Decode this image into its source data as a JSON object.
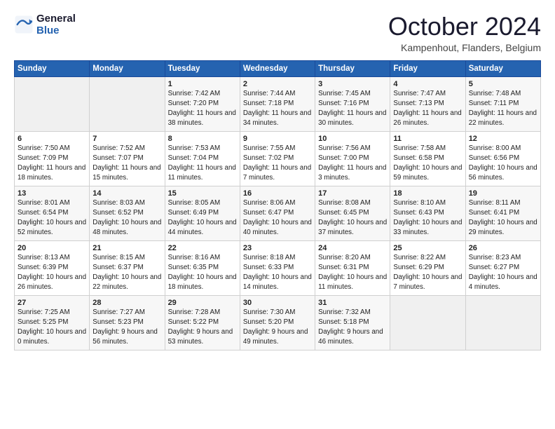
{
  "header": {
    "logo_line1": "General",
    "logo_line2": "Blue",
    "month": "October 2024",
    "location": "Kampenhout, Flanders, Belgium"
  },
  "days_of_week": [
    "Sunday",
    "Monday",
    "Tuesday",
    "Wednesday",
    "Thursday",
    "Friday",
    "Saturday"
  ],
  "weeks": [
    [
      {
        "day": "",
        "empty": true
      },
      {
        "day": "",
        "empty": true
      },
      {
        "day": "1",
        "sunrise": "7:42 AM",
        "sunset": "7:20 PM",
        "daylight": "11 hours and 38 minutes."
      },
      {
        "day": "2",
        "sunrise": "7:44 AM",
        "sunset": "7:18 PM",
        "daylight": "11 hours and 34 minutes."
      },
      {
        "day": "3",
        "sunrise": "7:45 AM",
        "sunset": "7:16 PM",
        "daylight": "11 hours and 30 minutes."
      },
      {
        "day": "4",
        "sunrise": "7:47 AM",
        "sunset": "7:13 PM",
        "daylight": "11 hours and 26 minutes."
      },
      {
        "day": "5",
        "sunrise": "7:48 AM",
        "sunset": "7:11 PM",
        "daylight": "11 hours and 22 minutes."
      }
    ],
    [
      {
        "day": "6",
        "sunrise": "7:50 AM",
        "sunset": "7:09 PM",
        "daylight": "11 hours and 18 minutes."
      },
      {
        "day": "7",
        "sunrise": "7:52 AM",
        "sunset": "7:07 PM",
        "daylight": "11 hours and 15 minutes."
      },
      {
        "day": "8",
        "sunrise": "7:53 AM",
        "sunset": "7:04 PM",
        "daylight": "11 hours and 11 minutes."
      },
      {
        "day": "9",
        "sunrise": "7:55 AM",
        "sunset": "7:02 PM",
        "daylight": "11 hours and 7 minutes."
      },
      {
        "day": "10",
        "sunrise": "7:56 AM",
        "sunset": "7:00 PM",
        "daylight": "11 hours and 3 minutes."
      },
      {
        "day": "11",
        "sunrise": "7:58 AM",
        "sunset": "6:58 PM",
        "daylight": "10 hours and 59 minutes."
      },
      {
        "day": "12",
        "sunrise": "8:00 AM",
        "sunset": "6:56 PM",
        "daylight": "10 hours and 56 minutes."
      }
    ],
    [
      {
        "day": "13",
        "sunrise": "8:01 AM",
        "sunset": "6:54 PM",
        "daylight": "10 hours and 52 minutes."
      },
      {
        "day": "14",
        "sunrise": "8:03 AM",
        "sunset": "6:52 PM",
        "daylight": "10 hours and 48 minutes."
      },
      {
        "day": "15",
        "sunrise": "8:05 AM",
        "sunset": "6:49 PM",
        "daylight": "10 hours and 44 minutes."
      },
      {
        "day": "16",
        "sunrise": "8:06 AM",
        "sunset": "6:47 PM",
        "daylight": "10 hours and 40 minutes."
      },
      {
        "day": "17",
        "sunrise": "8:08 AM",
        "sunset": "6:45 PM",
        "daylight": "10 hours and 37 minutes."
      },
      {
        "day": "18",
        "sunrise": "8:10 AM",
        "sunset": "6:43 PM",
        "daylight": "10 hours and 33 minutes."
      },
      {
        "day": "19",
        "sunrise": "8:11 AM",
        "sunset": "6:41 PM",
        "daylight": "10 hours and 29 minutes."
      }
    ],
    [
      {
        "day": "20",
        "sunrise": "8:13 AM",
        "sunset": "6:39 PM",
        "daylight": "10 hours and 26 minutes."
      },
      {
        "day": "21",
        "sunrise": "8:15 AM",
        "sunset": "6:37 PM",
        "daylight": "10 hours and 22 minutes."
      },
      {
        "day": "22",
        "sunrise": "8:16 AM",
        "sunset": "6:35 PM",
        "daylight": "10 hours and 18 minutes."
      },
      {
        "day": "23",
        "sunrise": "8:18 AM",
        "sunset": "6:33 PM",
        "daylight": "10 hours and 14 minutes."
      },
      {
        "day": "24",
        "sunrise": "8:20 AM",
        "sunset": "6:31 PM",
        "daylight": "10 hours and 11 minutes."
      },
      {
        "day": "25",
        "sunrise": "8:22 AM",
        "sunset": "6:29 PM",
        "daylight": "10 hours and 7 minutes."
      },
      {
        "day": "26",
        "sunrise": "8:23 AM",
        "sunset": "6:27 PM",
        "daylight": "10 hours and 4 minutes."
      }
    ],
    [
      {
        "day": "27",
        "sunrise": "7:25 AM",
        "sunset": "5:25 PM",
        "daylight": "10 hours and 0 minutes."
      },
      {
        "day": "28",
        "sunrise": "7:27 AM",
        "sunset": "5:23 PM",
        "daylight": "9 hours and 56 minutes."
      },
      {
        "day": "29",
        "sunrise": "7:28 AM",
        "sunset": "5:22 PM",
        "daylight": "9 hours and 53 minutes."
      },
      {
        "day": "30",
        "sunrise": "7:30 AM",
        "sunset": "5:20 PM",
        "daylight": "9 hours and 49 minutes."
      },
      {
        "day": "31",
        "sunrise": "7:32 AM",
        "sunset": "5:18 PM",
        "daylight": "9 hours and 46 minutes."
      },
      {
        "day": "",
        "empty": true
      },
      {
        "day": "",
        "empty": true
      }
    ]
  ]
}
